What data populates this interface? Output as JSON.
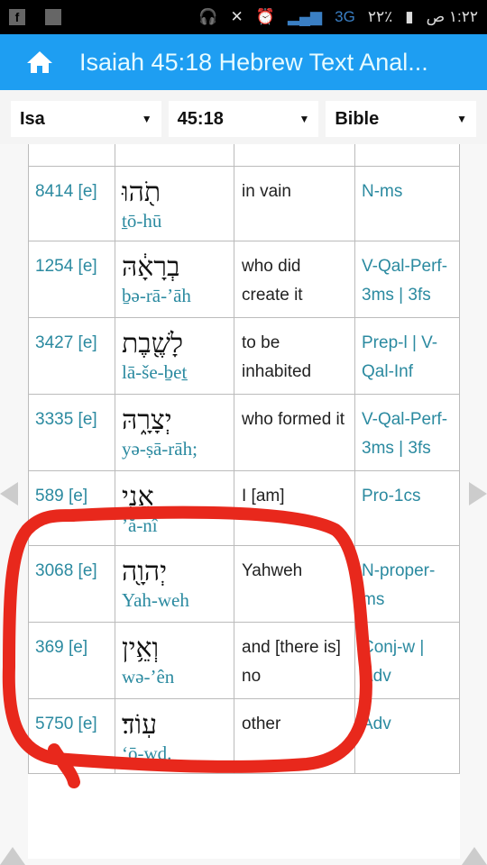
{
  "status_bar": {
    "network": "3G",
    "battery": "٢٢٪",
    "time": "١:٢٢ ص"
  },
  "header": {
    "title": "Isaiah 45:18 Hebrew Text Anal..."
  },
  "selectors": {
    "book": "Isa",
    "verse": "45:18",
    "version": "Bible"
  },
  "table": {
    "rows": [
      {
        "strongs": "",
        "hebrew": "",
        "translit": "",
        "english": "",
        "pos": ""
      },
      {
        "strongs": "8414 [e]",
        "hebrew": "תֹ֖הוּ",
        "translit": "ṯō-hū",
        "english": "in vain",
        "pos": "N-ms"
      },
      {
        "strongs": "1254 [e]",
        "hebrew": "בְרָאָ֔הּ",
        "translit": "ḇə-rā-’āh",
        "english": "who did create it",
        "pos": "V-Qal-Perf-3ms | 3fs"
      },
      {
        "strongs": "3427 [e]",
        "hebrew": "לָשֶׁ֖בֶת",
        "translit": "lā-še-ḇeṯ",
        "english": "to be inhabited",
        "pos": "Prep-l | V-Qal-Inf"
      },
      {
        "strongs": "3335 [e]",
        "hebrew": "יְצָרָ֑הּ",
        "translit": "yə-ṣā-rāh;",
        "english": "who formed it",
        "pos": "V-Qal-Perf-3ms | 3fs"
      },
      {
        "strongs": "589 [e]",
        "hebrew": "אֲנִ֥י",
        "translit": "’ă-nî",
        "english": "I [am]",
        "pos": "Pro-1cs"
      },
      {
        "strongs": "3068 [e]",
        "hebrew": "יְהוָ֖ה",
        "translit": "Yah-weh",
        "english": "Yahweh",
        "pos": "N-proper-ms"
      },
      {
        "strongs": "369 [e]",
        "hebrew": "וְאֵ֥ין",
        "translit": "wə-’ên",
        "english": "and [there is] no",
        "pos": "Conj-w | Adv"
      },
      {
        "strongs": "5750 [e]",
        "hebrew": "עֽוֹד׃",
        "translit": "‘ō-wḏ.",
        "english": "other",
        "pos": "Adv"
      }
    ]
  },
  "colors": {
    "appbar": "#1e9ef2",
    "link": "#2b8aa0",
    "annotation": "#e8281c"
  }
}
